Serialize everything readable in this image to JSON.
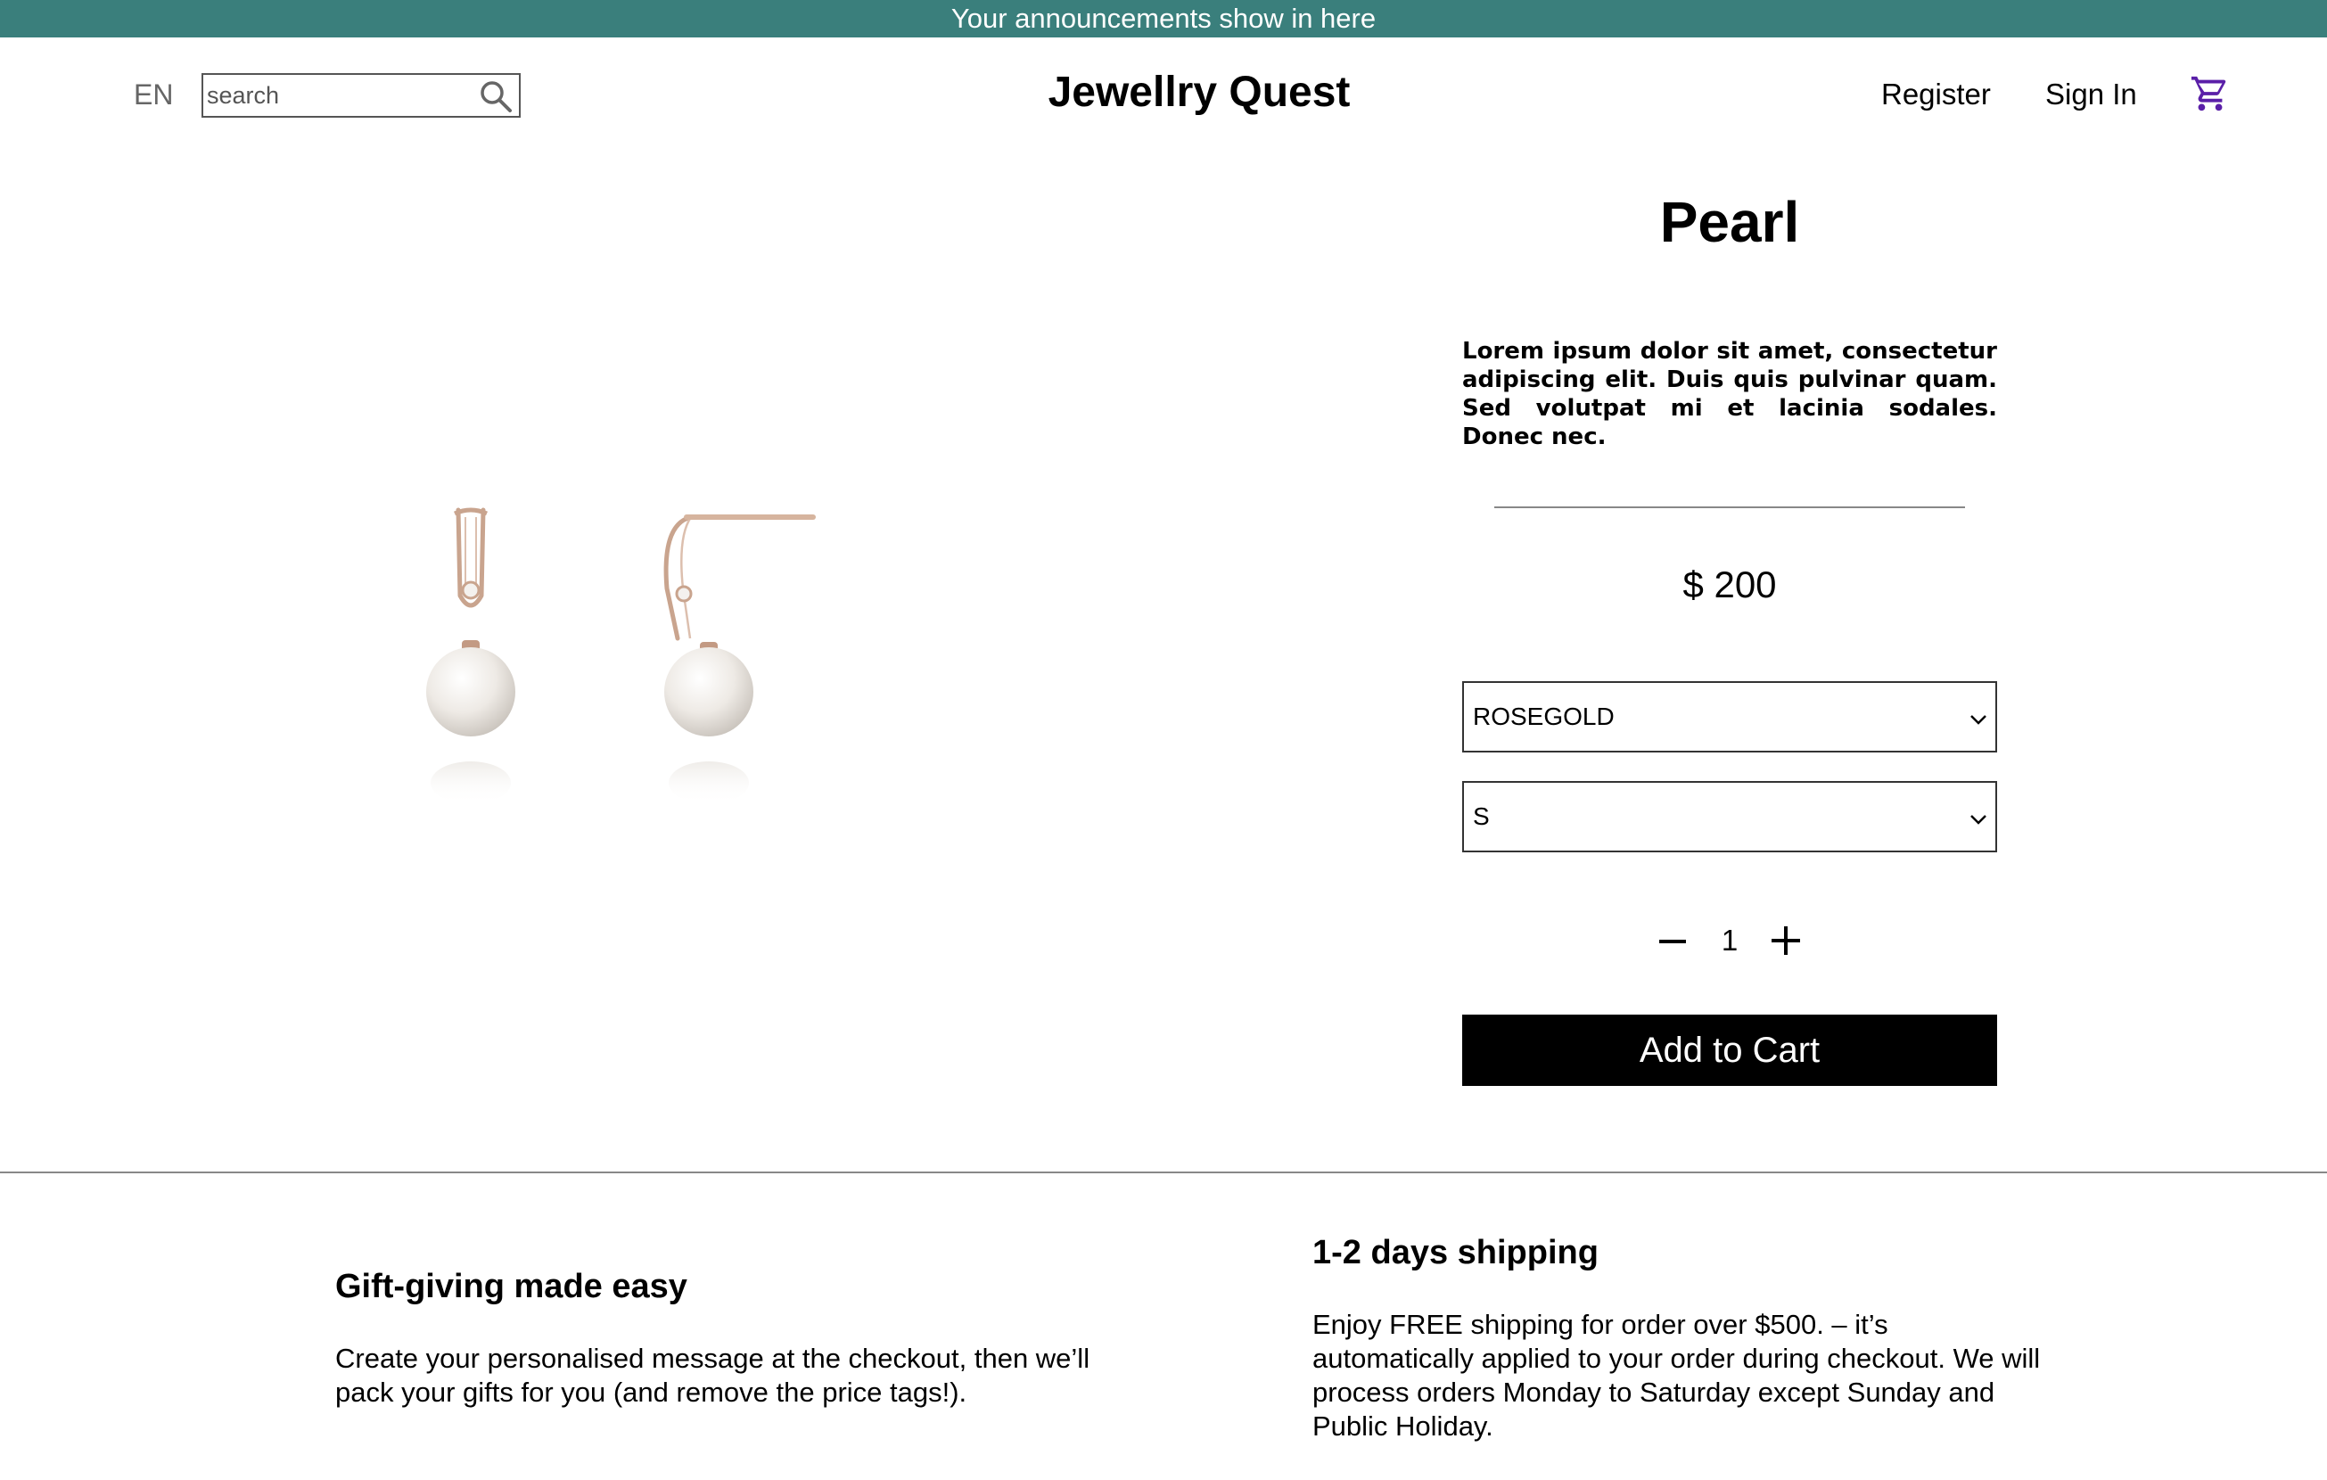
{
  "announcement": "Your announcements show in here",
  "header": {
    "language": "EN",
    "search_placeholder": "search",
    "logo": "Jewellry Quest",
    "register_label": "Register",
    "signin_label": "Sign In",
    "cart_icon": "cart-icon",
    "search_icon": "search-icon"
  },
  "product": {
    "title": "Pearl",
    "description": "Lorem ipsum dolor sit amet, consectetur adipiscing elit. Duis quis pulvinar quam. Sed volutpat mi et lacinia sodales. Donec nec.",
    "price": "$ 200",
    "color_option": "ROSEGOLD",
    "size_option": "S",
    "quantity": "1",
    "add_to_cart_label": "Add to Cart"
  },
  "features": {
    "gift": {
      "heading": "Gift-giving made easy",
      "body": "Create your personalised message at the checkout, then we’ll pack your gifts for you (and remove the price tags!)."
    },
    "shipping": {
      "heading": "1-2 days shipping",
      "body": "Enjoy FREE shipping for order over $500. – it’s automatically applied to your order during checkout. We will process orders Monday to Saturday except Sunday and Public Holiday."
    }
  },
  "colors": {
    "announcement_bg": "#3a7f7c",
    "cart_icon": "#5a1fa8",
    "button_bg": "#000000"
  }
}
